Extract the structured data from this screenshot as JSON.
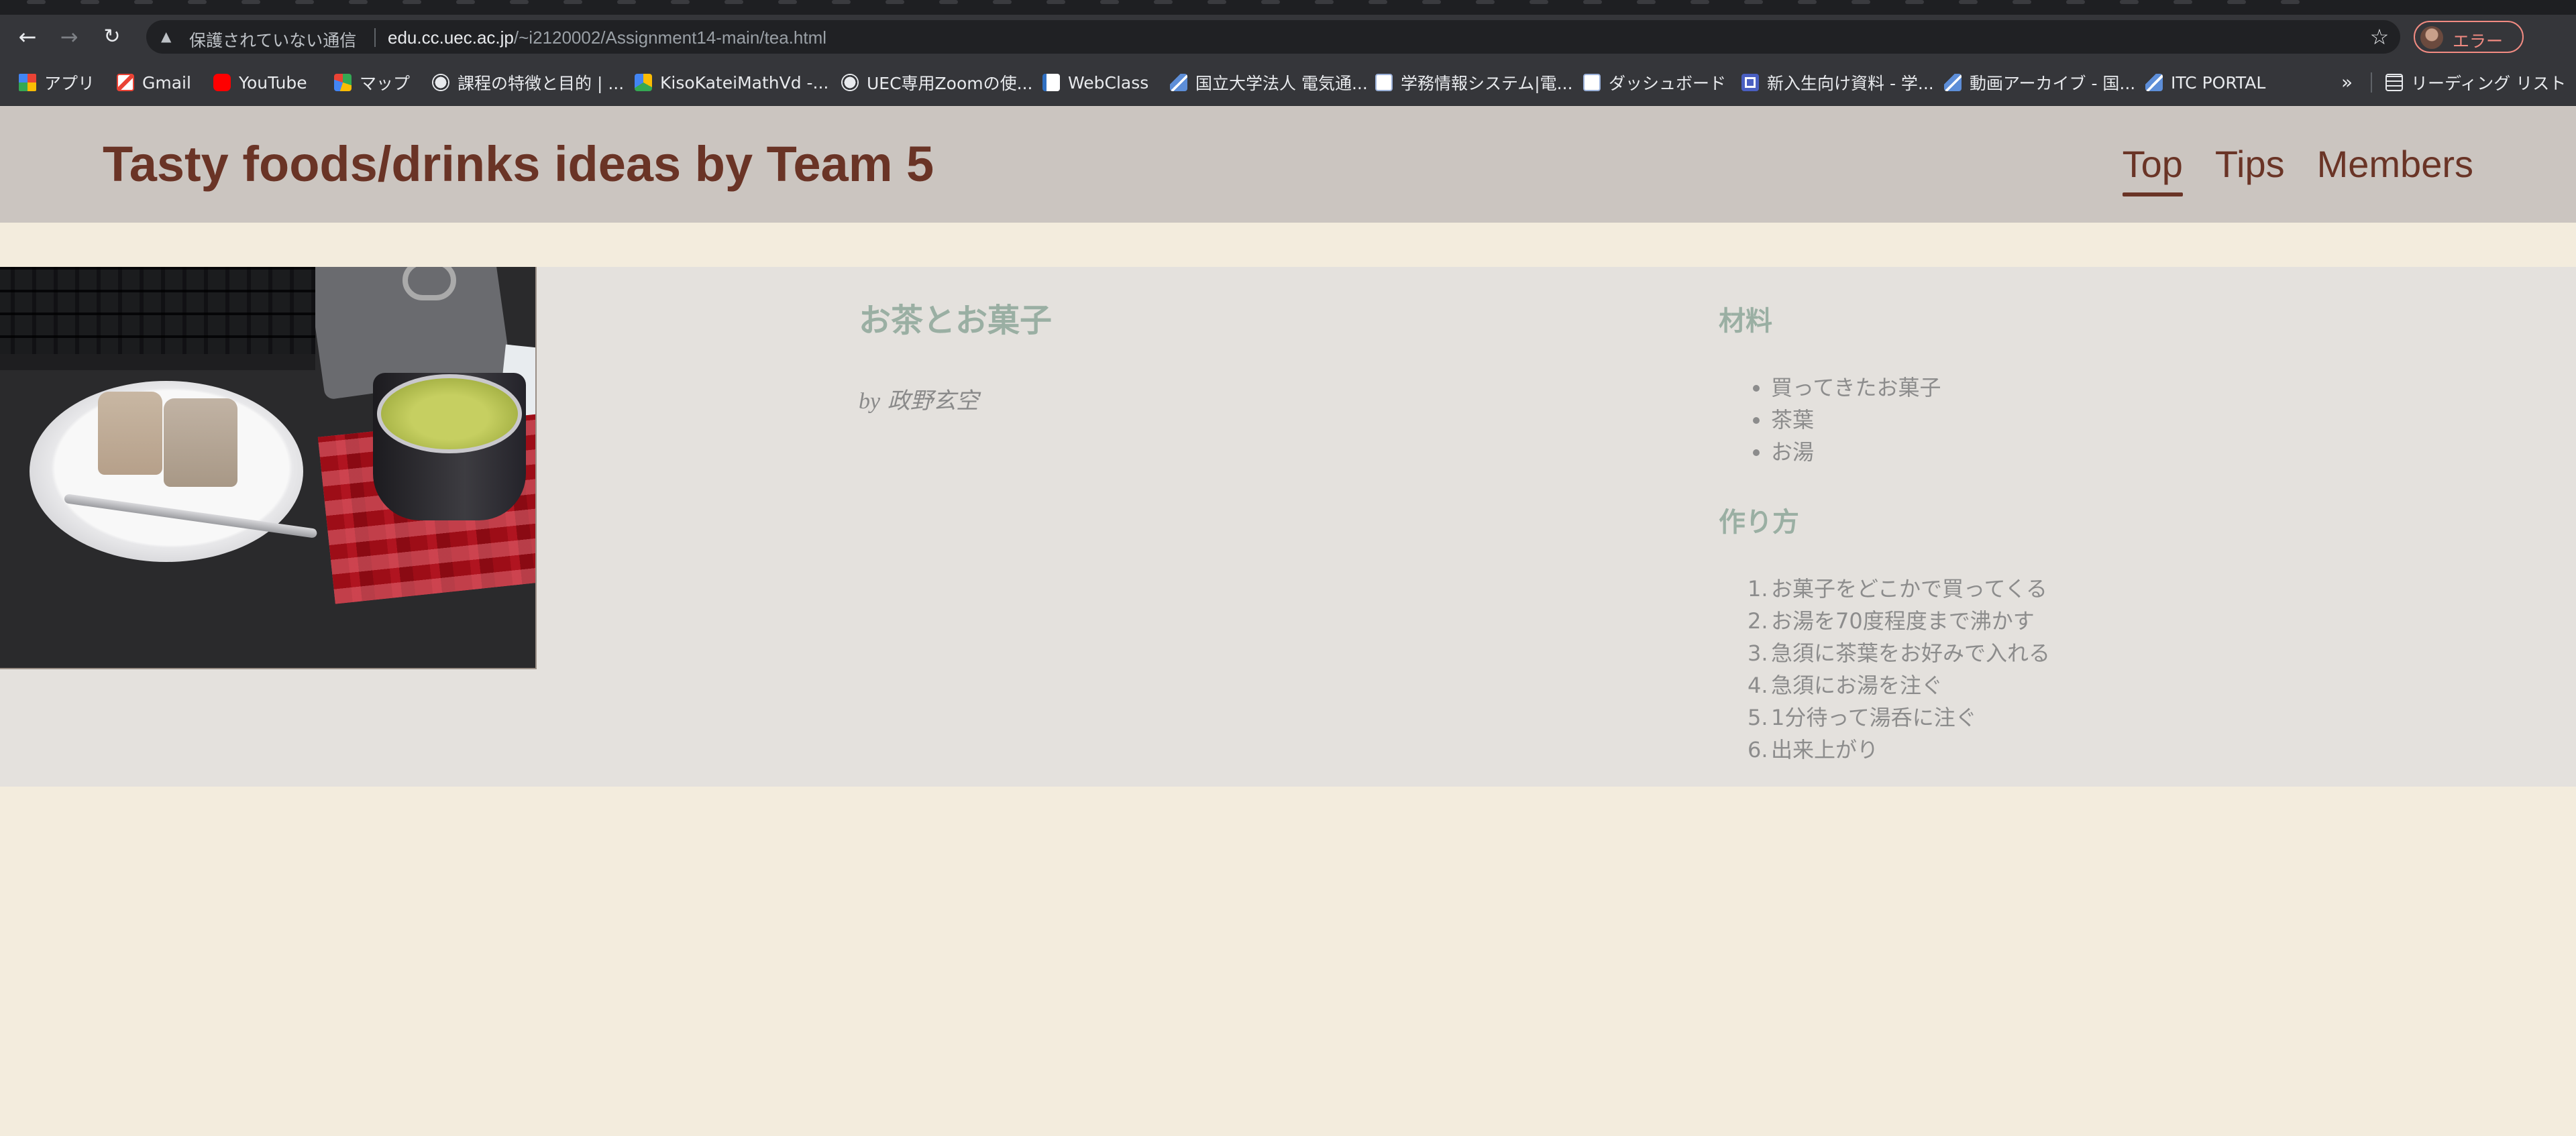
{
  "browser": {
    "security_label": "保護されていない通信",
    "url_host": "edu.cc.uec.ac.jp",
    "url_path": "/~i2120002/Assignment14-main/tea.html",
    "profile_label": "エラー",
    "bookmarks": [
      {
        "label": "アプリ",
        "icon": "apps-grid-icon"
      },
      {
        "label": "Gmail",
        "icon": "gmail-icon"
      },
      {
        "label": "YouTube",
        "icon": "youtube-icon"
      },
      {
        "label": "マップ",
        "icon": "maps-icon"
      },
      {
        "label": "課程の特徴と目的 | ...",
        "icon": "globe-icon"
      },
      {
        "label": "KisoKateiMathVd -...",
        "icon": "drive-icon"
      },
      {
        "label": "UEC専用Zoomの使...",
        "icon": "globe-icon"
      },
      {
        "label": "WebClass",
        "icon": "webclass-icon"
      },
      {
        "label": "国立大学法人 電気通...",
        "icon": "uec-icon"
      },
      {
        "label": "学務情報システム|電...",
        "icon": "uec-box-icon"
      },
      {
        "label": "ダッシュボード",
        "icon": "uec-box-icon"
      },
      {
        "label": "新入生向け資料 - 学...",
        "icon": "docs-icon"
      },
      {
        "label": "動画アーカイブ - 国...",
        "icon": "uec-icon"
      },
      {
        "label": "ITC PORTAL",
        "icon": "uec-icon"
      }
    ],
    "more_label": "»",
    "reading_list_label": "リーディング リスト"
  },
  "site": {
    "title": "Tasty foods/drinks ideas by Team 5",
    "nav": [
      "Top",
      "Tips",
      "Members"
    ]
  },
  "recipe": {
    "title": "お茶とお菓子",
    "author_by": "by",
    "author_name": "政野玄空",
    "ingredients_heading": "材料",
    "ingredients": [
      "買ってきたお菓子",
      "茶葉",
      "お湯"
    ],
    "steps_heading": "作り方",
    "steps": [
      {
        "num": "1.",
        "text": "お菓子をどこかで買ってくる"
      },
      {
        "num": "2.",
        "text": "お湯を70度程度まで沸かす"
      },
      {
        "num": "3.",
        "text": "急須に茶葉をお好みで入れる"
      },
      {
        "num": "4.",
        "text": "急須にお湯を注ぐ"
      },
      {
        "num": "5.",
        "text": "1分待って湯呑に注ぐ"
      },
      {
        "num": "6.",
        "text": "出来上がり"
      }
    ]
  },
  "colors": {
    "header_bg": "#cbc5c0",
    "brand_text": "#6a3426",
    "page_bg": "#f3ecdd",
    "card_bg": "#e4e1dd",
    "heading_accent": "#9aafa3"
  }
}
